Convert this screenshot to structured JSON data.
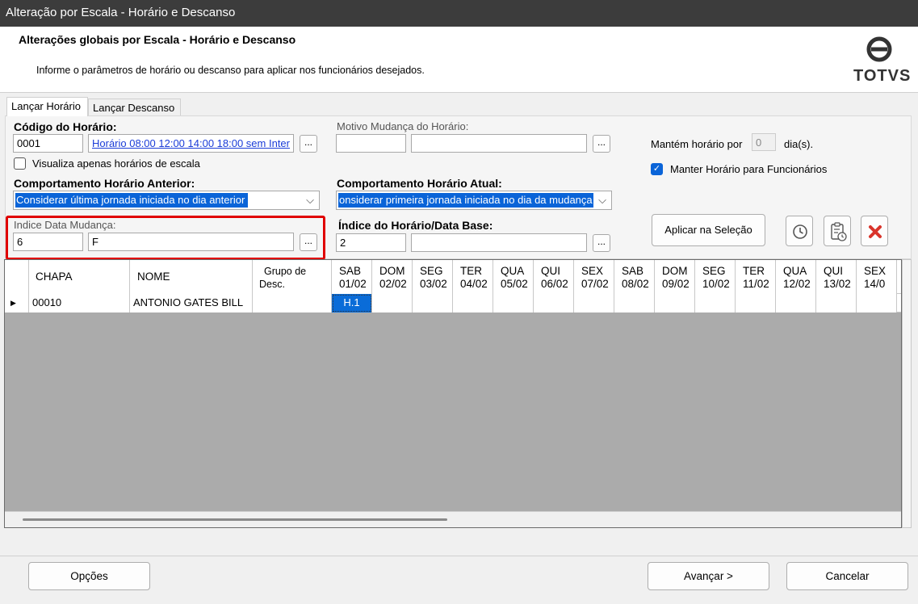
{
  "window": {
    "title": "Alteração por Escala - Horário e Descanso"
  },
  "header": {
    "title": "Alterações globais por Escala - Horário e Descanso",
    "subtitle": "Informe o parâmetros de horário ou descanso para aplicar nos funcionários desejados.",
    "logo_text": "TOTVS"
  },
  "tabs": [
    {
      "label": "Lançar Horário",
      "active": true
    },
    {
      "label": "Lançar Descanso",
      "active": false
    }
  ],
  "form": {
    "codigo_label": "Código do Horário:",
    "codigo_value": "0001",
    "codigo_desc": "Horário 08:00 12:00 14:00 18:00 sem Inter",
    "visualiza_label": "Visualiza apenas horários de escala",
    "visualiza_checked": false,
    "motivo_label": "Motivo Mudança do Horário:",
    "motivo_code": "",
    "motivo_desc": "",
    "mantem_prefix": "Mantém horário por",
    "mantem_value": "0",
    "mantem_suffix": "dia(s).",
    "manter_label": "Manter Horário para Funcionários",
    "manter_checked": true,
    "comp_anterior_label": "Comportamento Horário Anterior:",
    "comp_anterior_value": "Considerar última jornada iniciada no dia anterior",
    "comp_atual_label": "Comportamento Horário Atual:",
    "comp_atual_value": "onsiderar primeira jornada iniciada no dia da mudança",
    "indice_label": "Indice Data Mudança:",
    "indice_value": "6",
    "indice_desc": "F",
    "indice_base_label": "Índice do Horário/Data Base:",
    "indice_base_value": "2",
    "indice_base_desc": "",
    "dots": "...",
    "aplicar_label": "Aplicar na Seleção"
  },
  "grid": {
    "headers": {
      "chapa": "CHAPA",
      "nome": "NOME",
      "grupo1": "Grupo de",
      "grupo2": "Desc."
    },
    "days": [
      {
        "d": "SAB",
        "dt": "01/02"
      },
      {
        "d": "DOM",
        "dt": "02/02"
      },
      {
        "d": "SEG",
        "dt": "03/02"
      },
      {
        "d": "TER",
        "dt": "04/02"
      },
      {
        "d": "QUA",
        "dt": "05/02"
      },
      {
        "d": "QUI",
        "dt": "06/02"
      },
      {
        "d": "SEX",
        "dt": "07/02"
      },
      {
        "d": "SAB",
        "dt": "08/02"
      },
      {
        "d": "DOM",
        "dt": "09/02"
      },
      {
        "d": "SEG",
        "dt": "10/02"
      },
      {
        "d": "TER",
        "dt": "11/02"
      },
      {
        "d": "QUA",
        "dt": "12/02"
      },
      {
        "d": "QUI",
        "dt": "13/02"
      },
      {
        "d": "SEX",
        "dt": "14/0"
      }
    ],
    "rows": [
      {
        "chapa": "00010",
        "nome": "ANTONIO GATES BILL",
        "grupo": "",
        "cells": [
          "H.1"
        ]
      }
    ]
  },
  "footer": {
    "opcoes": "Opções",
    "avancar": "Avançar >",
    "cancelar": "Cancelar"
  }
}
